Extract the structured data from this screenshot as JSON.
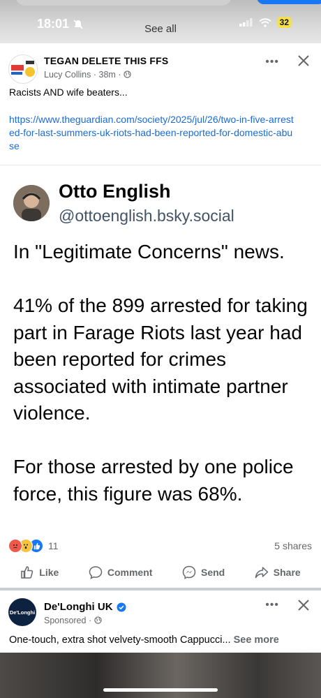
{
  "status_bar": {
    "time": "18:01",
    "center_text": "See all",
    "battery": "32"
  },
  "post": {
    "group_title": "TEGAN DELETE THIS FFS",
    "author": "Lucy Collins",
    "time": "38m",
    "text": "Racists AND wife beaters...",
    "link": "https://www.theguardian.com/society/2025/jul/26/two-in-five-arrested-for-last-summers-uk-riots-had-been-reported-for-domestic-abuse"
  },
  "embedded": {
    "name": "Otto English",
    "handle": "@ottoenglish.bsky.social",
    "paragraphs": [
      "In \"Legitimate Concerns\" news.",
      "41% of the 899 arrested for taking part in Farage Riots last year had been reported for crimes associated with intimate partner violence.",
      "For those arrested by one police force, this figure was 68%."
    ]
  },
  "stats": {
    "reaction_count": "11",
    "shares": "5 shares"
  },
  "actions": {
    "like": "Like",
    "comment": "Comment",
    "send": "Send",
    "share": "Share"
  },
  "ad": {
    "name": "De'Longhi UK",
    "sponsored": "Sponsored",
    "logo_text": "De'Longhi",
    "text": "One-touch, extra shot velvety-smooth Cappucci...",
    "see_more": "See more"
  },
  "colors": {
    "brand_blue": "#1877f2",
    "link": "#1a6bd6",
    "muted": "#65676b"
  }
}
